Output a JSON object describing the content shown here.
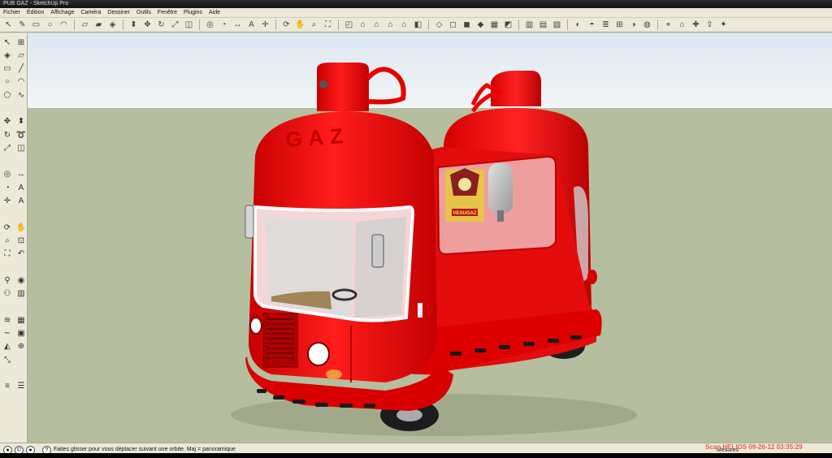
{
  "window": {
    "title": "PUB GAZ - SketchUp Pro"
  },
  "menu": [
    {
      "id": "file",
      "label": "Fichier"
    },
    {
      "id": "edit",
      "label": "Édition"
    },
    {
      "id": "view",
      "label": "Affichage"
    },
    {
      "id": "camera",
      "label": "Caméra"
    },
    {
      "id": "draw",
      "label": "Dessiner"
    },
    {
      "id": "tools",
      "label": "Outils"
    },
    {
      "id": "window",
      "label": "Fenêtre"
    },
    {
      "id": "plugins",
      "label": "Plugins"
    },
    {
      "id": "help",
      "label": "Aide"
    }
  ],
  "toolbar_icons": [
    "select-icon",
    "pencil-icon",
    "rectangle-icon",
    "circle-icon",
    "arc-icon",
    "sep",
    "eraser-icon",
    "eraser-alt-icon",
    "paint-bucket-icon",
    "sep",
    "push-pull-icon",
    "move-icon",
    "rotate-icon",
    "scale-icon",
    "offset-icon",
    "sep",
    "tape-measure-icon",
    "protractor-icon",
    "dimension-icon",
    "text-icon",
    "axes-icon",
    "sep",
    "orbit-icon",
    "pan-icon",
    "zoom-icon",
    "zoom-extents-icon",
    "sep",
    "iso-view-icon",
    "top-view-icon",
    "front-view-icon",
    "right-view-icon",
    "back-view-icon",
    "left-view-icon",
    "sep",
    "xray-icon",
    "wireframe-icon",
    "hidden-line-icon",
    "shaded-icon",
    "textured-icon",
    "monochrome-icon",
    "sep",
    "section-plane-icon",
    "section-display-icon",
    "section-cut-icon",
    "sep",
    "shadow-icon",
    "fog-icon",
    "layers-icon",
    "components-icon",
    "styles-icon",
    "materials-icon",
    "sep",
    "geo-location-icon",
    "warehouse-icon",
    "extension-icon",
    "share-icon",
    "plugin-icon"
  ],
  "left_tools": [
    "select-icon",
    "component-icon",
    "paint-bucket-icon",
    "eraser-icon",
    "rectangle-icon",
    "line-icon",
    "circle-icon",
    "arc-icon",
    "polygon-icon",
    "freehand-icon",
    "gap",
    "move-icon",
    "push-pull-icon",
    "rotate-icon",
    "follow-me-icon",
    "scale-icon",
    "offset-icon",
    "gap",
    "tape-measure-icon",
    "dimension-icon",
    "protractor-icon",
    "text-icon",
    "axes-icon",
    "3d-text-icon",
    "gap",
    "orbit-icon",
    "pan-icon",
    "zoom-icon",
    "zoom-window-icon",
    "zoom-extents-icon",
    "previous-view-icon",
    "gap",
    "position-camera-icon",
    "look-around-icon",
    "walk-icon",
    "section-plane-icon",
    "gap",
    "sandbox-from-contours-icon",
    "sandbox-from-scratch-icon",
    "smoove-icon",
    "stamp-icon",
    "drape-icon",
    "add-detail-icon",
    "flip-edge-icon",
    "gap",
    "layer-tool-icon",
    "outliner-icon"
  ],
  "model": {
    "brand_text": "GAZ",
    "poster_text": "VESUGAZ",
    "colors": {
      "body": "#ee1010",
      "body_shadow": "#b50000",
      "sky": "#e6eef4",
      "ground": "#b5be9e"
    }
  },
  "status": {
    "text": "Faites glisser pour vous déplacer suivant une orbite.  Maj = panoramique",
    "measures_label": "Mesures",
    "watermark": "Scan HELIOS 09-26-12 03:35:29"
  }
}
